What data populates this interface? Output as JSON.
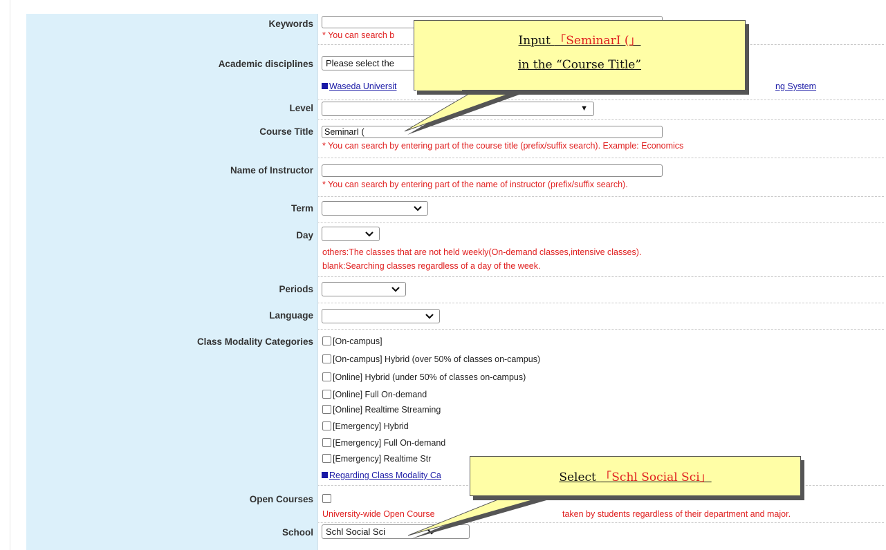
{
  "form": {
    "keywords": {
      "label": "Keywords",
      "value": "",
      "note": "* You can search b"
    },
    "academic": {
      "label": "Academic disciplines",
      "select_value": "Please select the",
      "link_left": "Waseda Universit",
      "link_right": "ng System"
    },
    "level": {
      "label": "Level",
      "select_value": ""
    },
    "course_title": {
      "label": "Course Title",
      "value": "SeminarI (",
      "note": "* You can search by entering part of the course title (prefix/suffix search).  Example: Economics"
    },
    "instructor": {
      "label": "Name of Instructor",
      "value": "",
      "note": "* You can search by entering part of the name of instructor (prefix/suffix search)."
    },
    "term": {
      "label": "Term",
      "select_value": ""
    },
    "day": {
      "label": "Day",
      "select_value": "",
      "note1": "others:The classes that are not held weekly(On-demand classes,intensive classes).",
      "note2": "blank:Searching classes regardless of a day of the week."
    },
    "periods": {
      "label": "Periods",
      "select_value": ""
    },
    "language": {
      "label": "Language",
      "select_value": ""
    },
    "modality": {
      "label": "Class Modality Categories",
      "options": [
        "[On-campus]",
        "[On-campus] Hybrid (over 50% of classes on-campus)",
        "[Online] Hybrid (under 50% of classes on-campus)",
        "[Online] Full On-demand",
        "[Online] Realtime Streaming",
        "[Emergency] Hybrid",
        "[Emergency] Full On-demand",
        "[Emergency] Realtime Str"
      ],
      "link": "Regarding Class Modality Ca"
    },
    "open_courses": {
      "label": "Open Courses",
      "note_left": "University-wide Open Course",
      "note_right": "taken by students regardless of their department and major."
    },
    "school": {
      "label": "School",
      "select_value": "Schl Social Sci"
    }
  },
  "callouts": {
    "top": {
      "prefix": "Input ",
      "highlight": "「SeminarI (」",
      "line2": "in the “Course Title”"
    },
    "bottom": {
      "prefix": "Select ",
      "highlight": "「Schl Social Sci」"
    }
  },
  "icons": {
    "dropdown": "chevron-down-icon",
    "checkbox": "checkbox-icon",
    "link_square": "square-bullet-icon"
  },
  "colors": {
    "label_bg": "#dcf0fa",
    "note_red": "#e02020",
    "link_blue": "#1a1aa6",
    "callout_bg": "#fffea6"
  }
}
